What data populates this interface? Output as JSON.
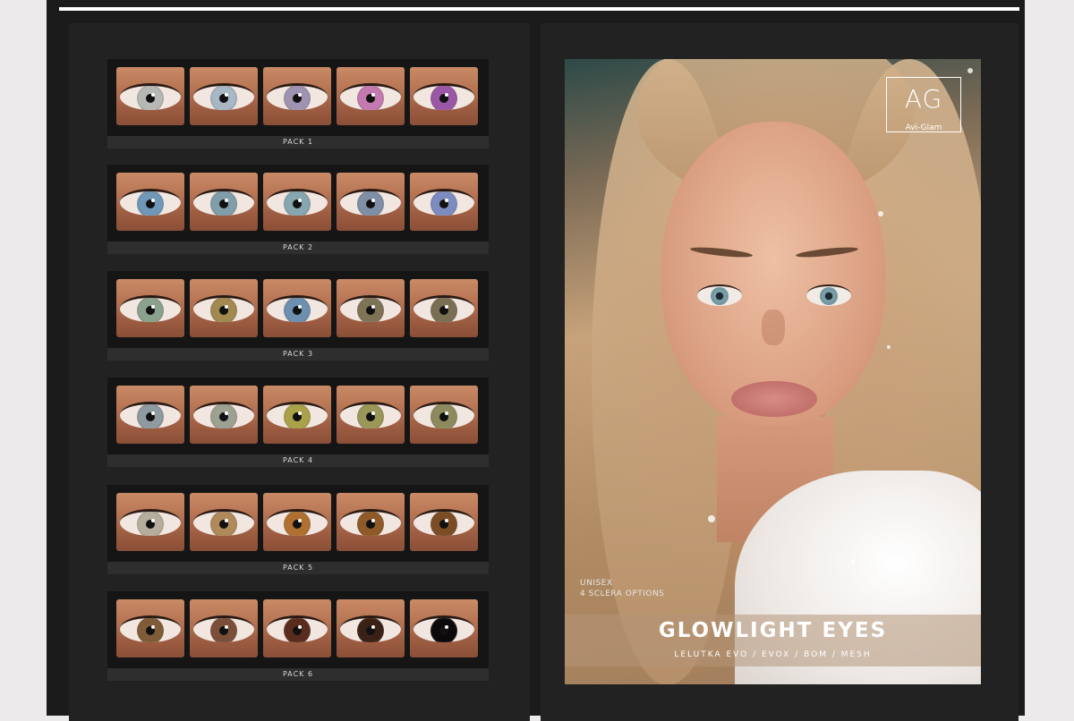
{
  "colors": {
    "page_background": "#eceaea",
    "frame": "#1b1b1b",
    "panel": "#222222",
    "swatch_box": "#151515",
    "pack_label_bar": "#2e2e2e",
    "top_rule": "#ffffff"
  },
  "packs": [
    {
      "label": "PACK 1",
      "iris_colors": [
        "#b5b8b4",
        "#a7b7c4",
        "#9f93b2",
        "#c47ab0",
        "#9a57a6"
      ]
    },
    {
      "label": "PACK 2",
      "iris_colors": [
        "#6f97b8",
        "#7f9ea9",
        "#86a6b0",
        "#7e8fa7",
        "#7c8cc0"
      ]
    },
    {
      "label": "PACK 3",
      "iris_colors": [
        "#8aa28d",
        "#a2894f",
        "#6d8fb0",
        "#7f7356",
        "#7a6f53"
      ]
    },
    {
      "label": "PACK 4",
      "iris_colors": [
        "#8f9aa1",
        "#9da192",
        "#a9a248",
        "#9a9758",
        "#8d8b5e"
      ]
    },
    {
      "label": "PACK 5",
      "iris_colors": [
        "#b5ae9d",
        "#b08a5a",
        "#b07030",
        "#8e5a28",
        "#7c4d24"
      ]
    },
    {
      "label": "PACK 6",
      "iris_colors": [
        "#7f5b37",
        "#7a4f37",
        "#5a2c1e",
        "#3a2116",
        "#0b0909"
      ]
    }
  ],
  "poster": {
    "logo_mark": "AG",
    "logo_name": "Avi-Glam",
    "tag_line_1": "UNISEX",
    "tag_line_2": "4 SCLERA OPTIONS",
    "title": "GLOWLIGHT EYES",
    "platforms": "LELUTKA EVO  /  EVOX  /  BOM  /  MESH"
  }
}
